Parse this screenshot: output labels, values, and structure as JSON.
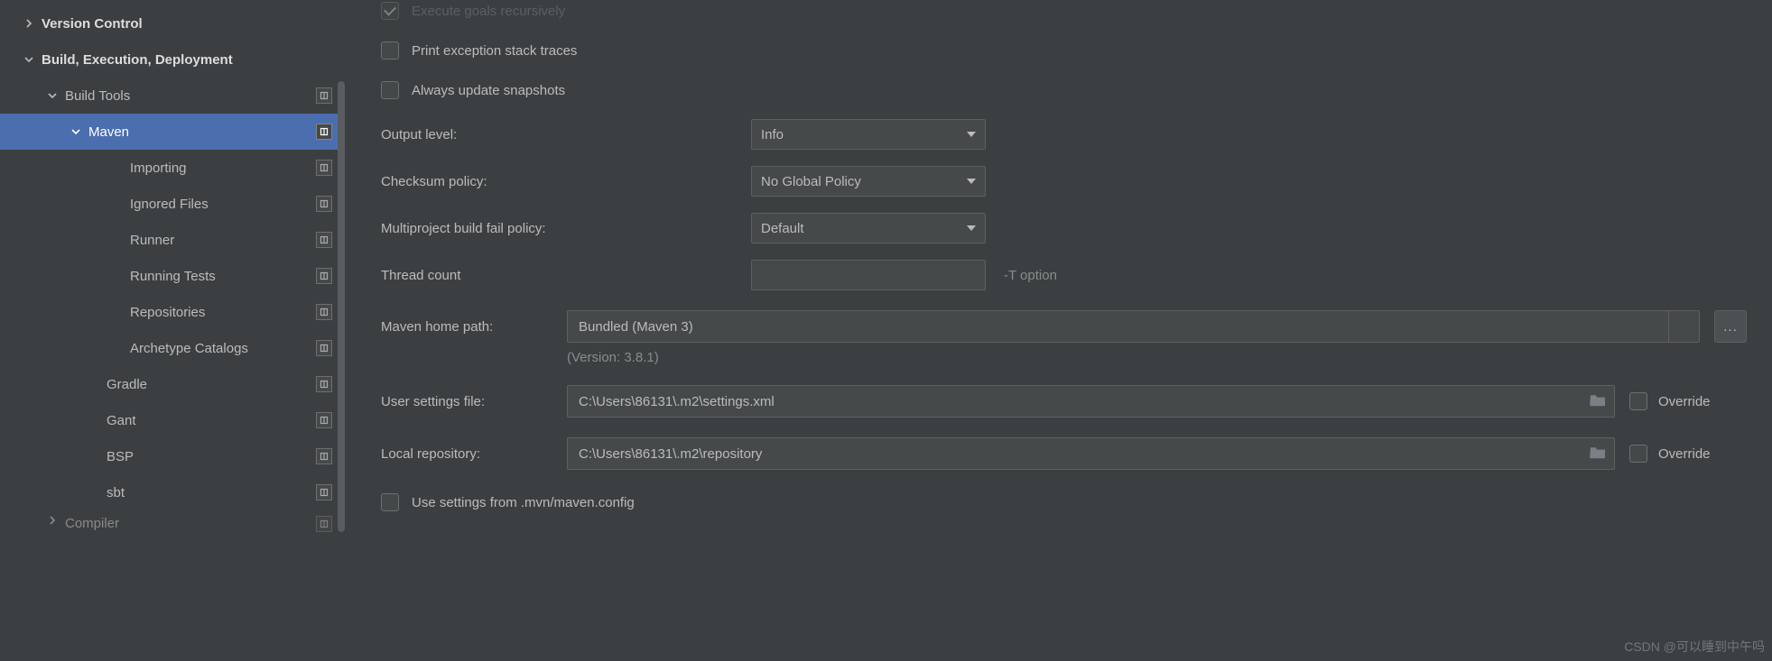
{
  "sidebar": {
    "items": [
      {
        "label": "Version Control",
        "indent": 24,
        "arrow": "right",
        "bold": true,
        "marker": false
      },
      {
        "label": "Build, Execution, Deployment",
        "indent": 24,
        "arrow": "down",
        "bold": true,
        "marker": false
      },
      {
        "label": "Build Tools",
        "indent": 50,
        "arrow": "down",
        "bold": false,
        "marker": true
      },
      {
        "label": "Maven",
        "indent": 76,
        "arrow": "down",
        "bold": false,
        "marker": true,
        "selected": true
      },
      {
        "label": "Importing",
        "indent": 122,
        "arrow": "",
        "bold": false,
        "marker": true
      },
      {
        "label": "Ignored Files",
        "indent": 122,
        "arrow": "",
        "bold": false,
        "marker": true
      },
      {
        "label": "Runner",
        "indent": 122,
        "arrow": "",
        "bold": false,
        "marker": true
      },
      {
        "label": "Running Tests",
        "indent": 122,
        "arrow": "",
        "bold": false,
        "marker": true
      },
      {
        "label": "Repositories",
        "indent": 122,
        "arrow": "",
        "bold": false,
        "marker": true
      },
      {
        "label": "Archetype Catalogs",
        "indent": 122,
        "arrow": "",
        "bold": false,
        "marker": true
      },
      {
        "label": "Gradle",
        "indent": 96,
        "arrow": "",
        "bold": false,
        "marker": true
      },
      {
        "label": "Gant",
        "indent": 96,
        "arrow": "",
        "bold": false,
        "marker": true
      },
      {
        "label": "BSP",
        "indent": 96,
        "arrow": "",
        "bold": false,
        "marker": true
      },
      {
        "label": "sbt",
        "indent": 96,
        "arrow": "",
        "bold": false,
        "marker": true
      },
      {
        "label": "Compiler",
        "indent": 50,
        "arrow": "right",
        "bold": false,
        "marker": true,
        "cutoff": true
      }
    ]
  },
  "form": {
    "execute_goals": {
      "label": "Execute goals recursively",
      "checked": true
    },
    "print_exception": {
      "label": "Print exception stack traces",
      "checked": false
    },
    "always_update": {
      "label": "Always update snapshots",
      "checked": false
    },
    "output_level": {
      "label": "Output level:",
      "value": "Info"
    },
    "checksum_policy": {
      "label": "Checksum policy:",
      "value": "No Global Policy"
    },
    "fail_policy": {
      "label": "Multiproject build fail policy:",
      "value": "Default"
    },
    "thread_count": {
      "label": "Thread count",
      "value": "",
      "hint": "-T option"
    },
    "maven_home": {
      "label": "Maven home path:",
      "value": "Bundled (Maven 3)",
      "version": "(Version: 3.8.1)",
      "browse": "..."
    },
    "user_settings": {
      "label": "User settings file:",
      "value": "C:\\Users\\86131\\.m2\\settings.xml",
      "override": "Override"
    },
    "local_repo": {
      "label": "Local repository:",
      "value": "C:\\Users\\86131\\.m2\\repository",
      "override": "Override"
    },
    "use_mvn_config": {
      "label": "Use settings from .mvn/maven.config",
      "checked": false
    }
  },
  "watermark": "CSDN @可以睡到中午吗"
}
